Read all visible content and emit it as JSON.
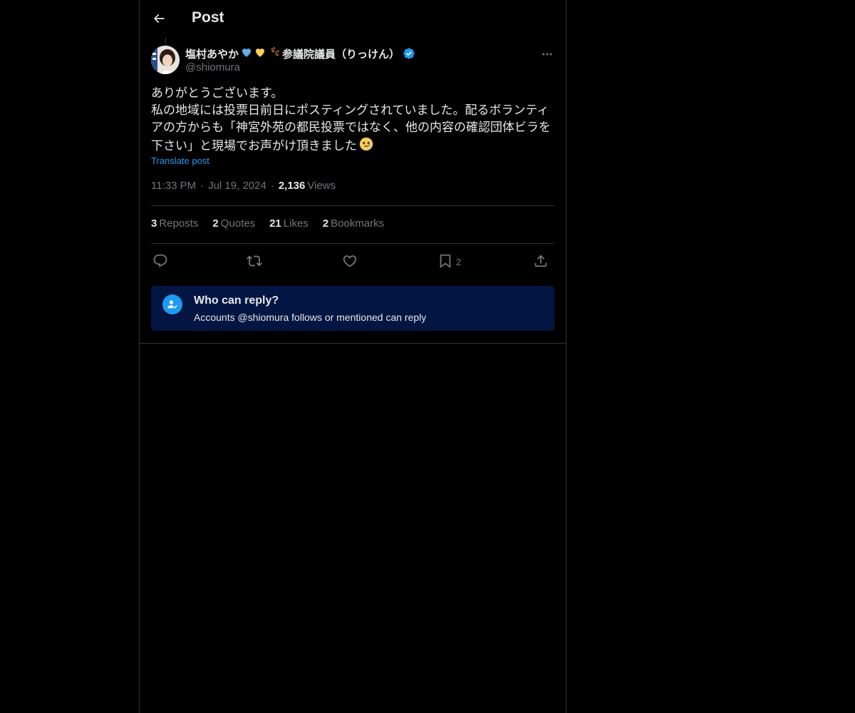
{
  "header": {
    "title": "Post",
    "back_icon": "arrow-left-icon"
  },
  "author": {
    "display_name": "塩村あやか",
    "display_name_suffix": "参議院議員（りっけん）",
    "name_emojis": [
      "blue-heart-emoji",
      "yellow-heart-emoji",
      "paw-prints-emoji"
    ],
    "handle": "@shiomura",
    "verified": true,
    "verified_color": "#1d9bf0"
  },
  "post": {
    "text": "ありがとうございます。\n私の地域には投票日前日にポスティングされていました。配るボランティアの方からも「神宮外苑の都民投票ではなく、他の内容の確認団体ビラを下さい」と現場でお声がけ頂きました",
    "trailing_emoji": "face-holding-back-tears-emoji",
    "translate_label": "Translate post",
    "time": "11:33 PM",
    "date": "Jul 19, 2024",
    "views_count": "2,136",
    "views_label": "Views"
  },
  "stats": {
    "reposts_count": "3",
    "reposts_label": "Reposts",
    "quotes_count": "2",
    "quotes_label": "Quotes",
    "likes_count": "21",
    "likes_label": "Likes",
    "bookmarks_count": "2",
    "bookmarks_label": "Bookmarks"
  },
  "actions": {
    "bookmark_count": "2",
    "icons": [
      "reply-icon",
      "repost-icon",
      "like-icon",
      "bookmark-icon",
      "share-icon"
    ]
  },
  "reply_restriction": {
    "title": "Who can reply?",
    "subtitle": "Accounts @shiomura follows or mentioned can reply",
    "box_color": "#031542"
  },
  "colors": {
    "background": "#000000",
    "text": "#e7e9ea",
    "secondary": "#71767b",
    "accent": "#1d9bf0",
    "border": "#2f3336"
  }
}
